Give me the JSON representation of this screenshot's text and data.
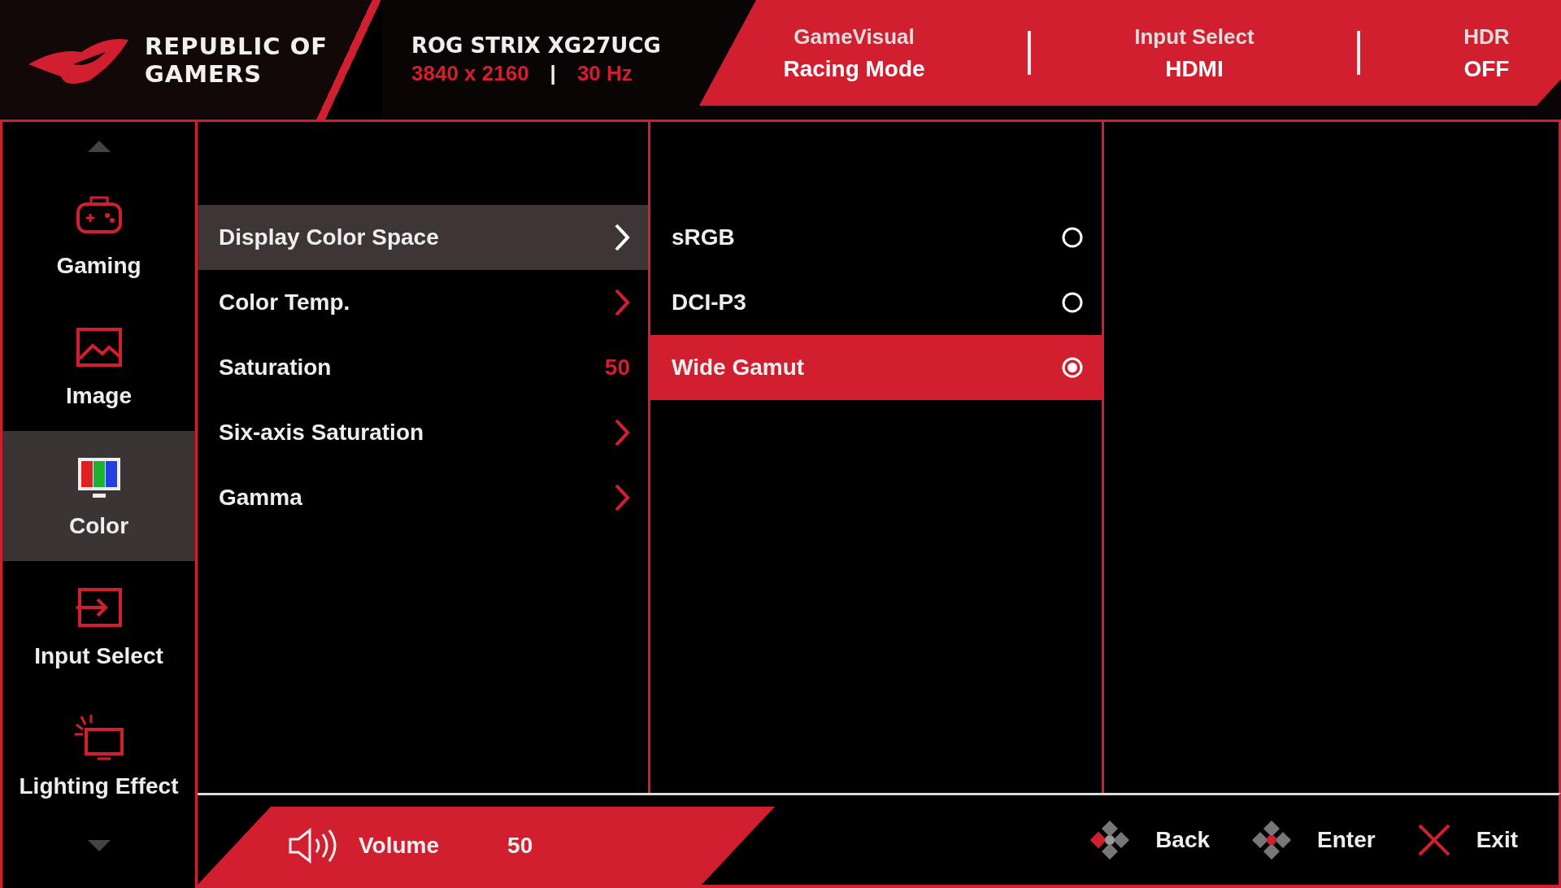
{
  "header": {
    "brand": "REPUBLIC OF GAMERS",
    "model": "ROG STRIX XG27UCG",
    "resolution": "3840 x 2160",
    "separator": "|",
    "refresh_rate": "30 Hz",
    "status": [
      {
        "label": "GameVisual",
        "value": "Racing Mode"
      },
      {
        "label": "Input Select",
        "value": "HDMI"
      },
      {
        "label": "HDR",
        "value": "OFF"
      }
    ]
  },
  "sidebar": {
    "items": [
      {
        "kind": "gaming",
        "label": "Gaming",
        "selected": false
      },
      {
        "kind": "image",
        "label": "Image",
        "selected": false
      },
      {
        "kind": "color",
        "label": "Color",
        "selected": true
      },
      {
        "kind": "input",
        "label": "Input Select",
        "selected": false
      },
      {
        "kind": "lighting",
        "label": "Lighting Effect",
        "selected": false
      }
    ]
  },
  "menu": {
    "items": [
      {
        "kind": "submenu",
        "label": "Display Color Space",
        "selected": true
      },
      {
        "kind": "submenu",
        "label": "Color Temp.",
        "selected": false
      },
      {
        "kind": "value",
        "label": "Saturation",
        "value": "50",
        "selected": false
      },
      {
        "kind": "submenu",
        "label": "Six-axis Saturation",
        "selected": false
      },
      {
        "kind": "submenu",
        "label": "Gamma",
        "selected": false
      }
    ]
  },
  "options": [
    {
      "label": "sRGB",
      "selected": false
    },
    {
      "label": "DCI-P3",
      "selected": false
    },
    {
      "label": "Wide Gamut",
      "selected": true
    }
  ],
  "footer": {
    "volume": {
      "label": "Volume",
      "value": "50"
    },
    "hints": [
      {
        "kind": "back",
        "label": "Back"
      },
      {
        "kind": "enter",
        "label": "Enter"
      },
      {
        "kind": "exit",
        "label": "Exit"
      }
    ]
  }
}
